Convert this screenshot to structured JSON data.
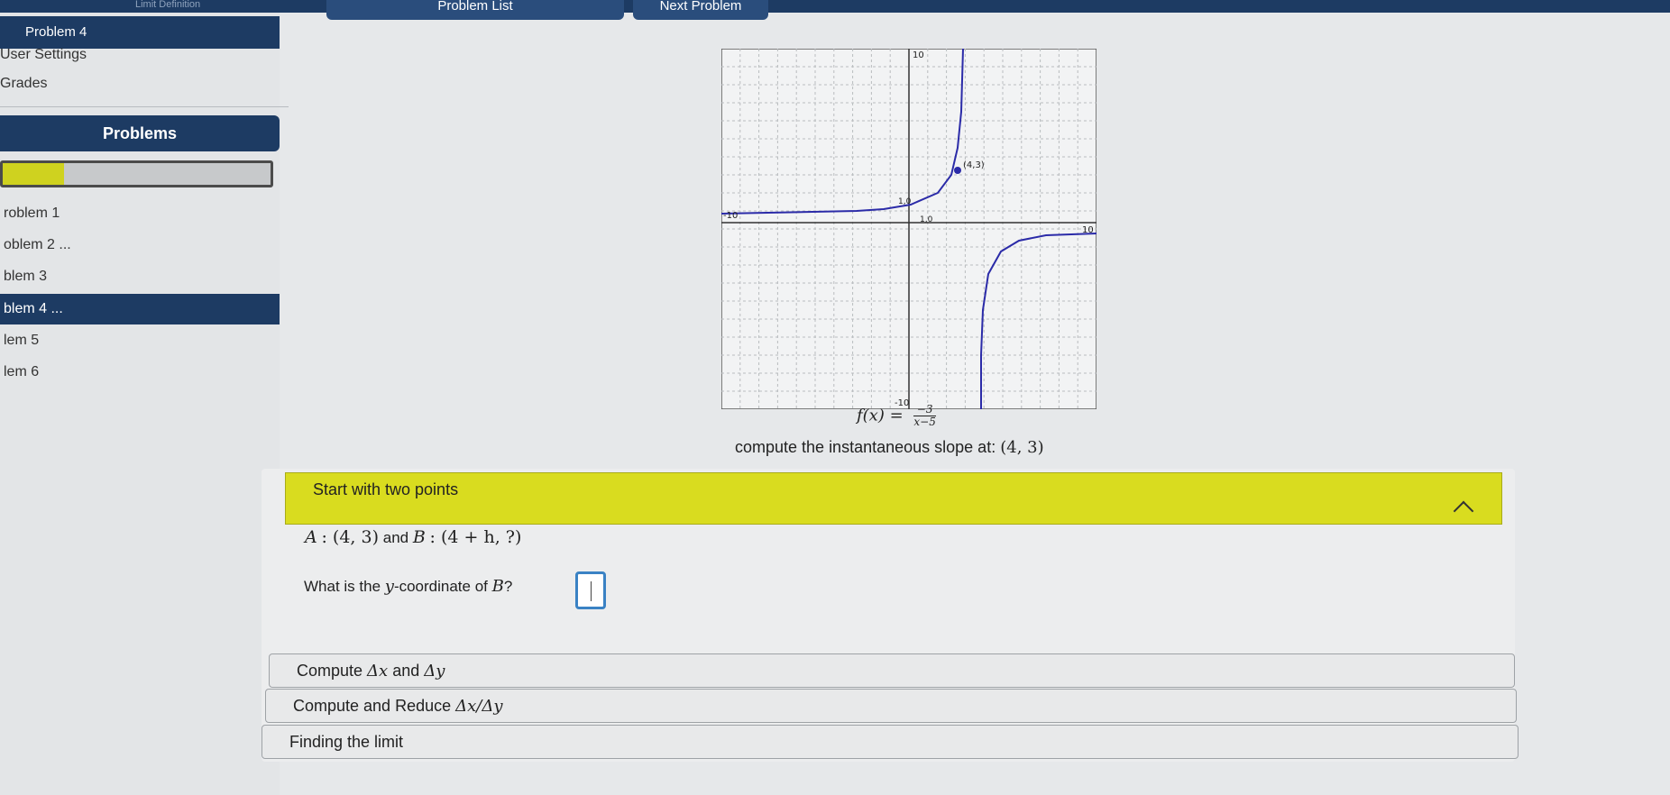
{
  "topbar": {
    "crumb": "Limit Definition",
    "list_label": "Problem List",
    "next_label": "Next Problem"
  },
  "sidebar": {
    "current_problem": "Problem 4",
    "links": [
      "User Settings",
      "Grades"
    ],
    "problems_header": "Problems",
    "progress_fraction": 0.23,
    "items": [
      {
        "label": "roblem 1"
      },
      {
        "label": "oblem 2 ..."
      },
      {
        "label": "blem 3"
      },
      {
        "label": "blem 4 ...",
        "active": true
      },
      {
        "label": "lem 5"
      },
      {
        "label": "lem 6"
      }
    ]
  },
  "graph": {
    "function_lhs": "f(x) =",
    "numerator": "−3",
    "denominator": "x−5",
    "point_label": "(4,3)",
    "x_min_label": "-10",
    "x_max_label": "10",
    "y_max_label": "10",
    "y_min_label": "-10",
    "y_one_label": "1,0",
    "x_one_label": "1,0",
    "colors": {
      "curve": "#2b2ba8",
      "grid": "#b9bcbf"
    }
  },
  "prompt": {
    "text": "compute the instantaneous slope at:",
    "point": "(4, 3)"
  },
  "accordion": {
    "section_title": "Start with two points",
    "point_a_name": "A",
    "point_a": ": (4, 3)",
    "and_text": "and",
    "point_b_name": "B",
    "point_b": ": (4 + h, ?)",
    "question_prefix": "What is the ",
    "question_var": "y",
    "question_mid": "-coordinate of ",
    "question_point": "B",
    "question_suffix": "?",
    "answer_value": "",
    "steps": [
      {
        "label": "Compute ",
        "math": "Δx",
        "mid": " and ",
        "math2": "Δy"
      },
      {
        "label": "Compute and Reduce ",
        "math": "Δx/Δy",
        "mid": "",
        "math2": ""
      },
      {
        "label": "Finding the limit",
        "math": "",
        "mid": "",
        "math2": ""
      }
    ],
    "colors": {
      "header": "#d9dc1f",
      "active_nav": "#1d3b63"
    }
  }
}
